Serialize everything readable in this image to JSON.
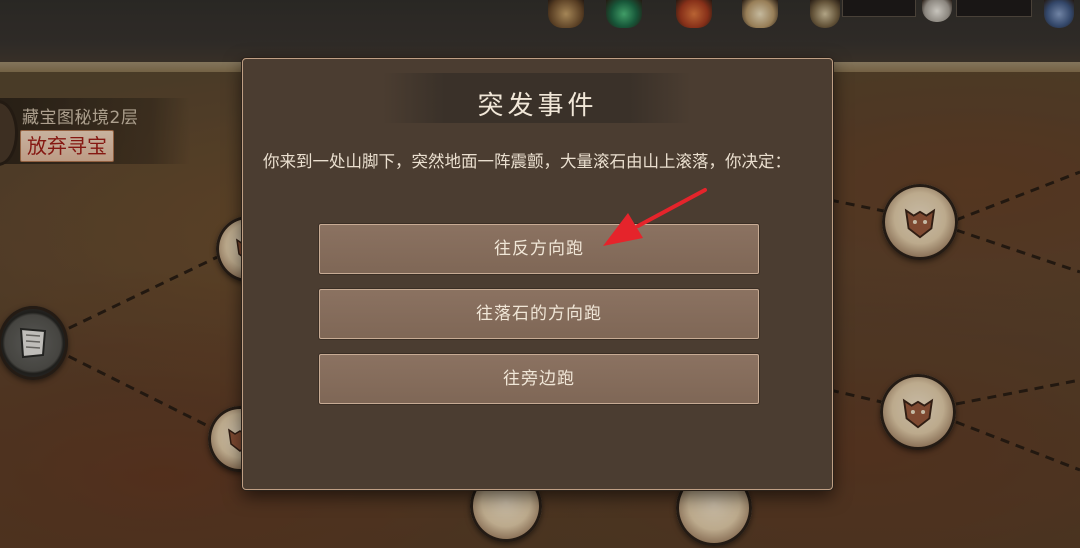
{
  "location": {
    "title": "藏宝图秘境2层",
    "abandon_label": "放弃寻宝"
  },
  "event_dialog": {
    "title": "突发事件",
    "description": "你来到一处山脚下，突然地面一阵震颤，大量滚石由山上滚落，你决定：",
    "choices": [
      {
        "label": "往反方向跑"
      },
      {
        "label": "往落石的方向跑"
      },
      {
        "label": "往旁边跑"
      }
    ]
  },
  "colors": {
    "annotation_arrow": "#e5242b",
    "abandon_text": "#a31e17",
    "dialog_border": "#bf9f84"
  }
}
